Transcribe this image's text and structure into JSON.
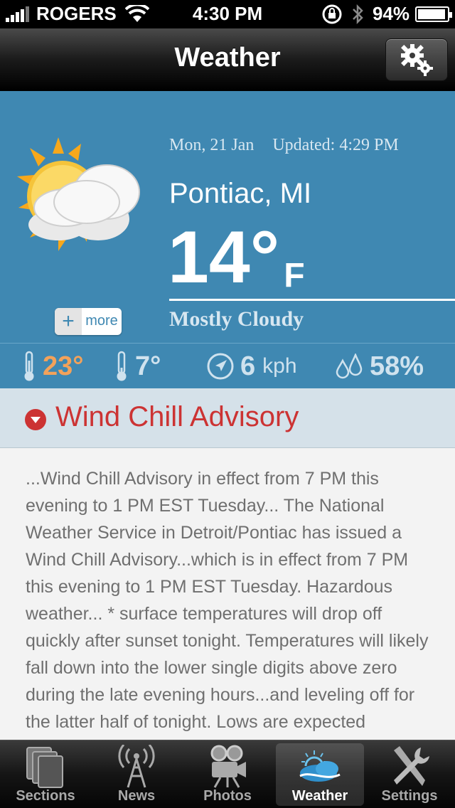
{
  "status_bar": {
    "carrier": "ROGERS",
    "time": "4:30 PM",
    "battery": "94%",
    "battery_level": 0.94
  },
  "nav": {
    "title": "Weather",
    "settings_icon": "gear-icon"
  },
  "current": {
    "date": "Mon, 21 Jan",
    "updated": "Updated: 4:29 PM",
    "location": "Pontiac, MI",
    "temperature": "14°",
    "unit": "F",
    "condition": "Mostly Cloudy",
    "condition_icon": "sun-cloud-icon",
    "more_label": "more",
    "more_symbol": "+"
  },
  "stats": {
    "high": "23°",
    "low": "7°",
    "wind_speed": "6",
    "wind_unit": "kph",
    "humidity": "58%"
  },
  "advisory": {
    "title": "Wind Chill Advisory",
    "body": "...Wind Chill Advisory in effect from 7 PM this evening to 1 PM EST Tuesday... The National Weather Service in Detroit/Pontiac has issued a Wind Chill Advisory...which is in effect from 7 PM this evening to 1 PM EST Tuesday. Hazardous weather... * surface temperatures will drop off quickly after sunset tonight. Temperatures will likely fall down into the lower single digits above zero during the late evening hours...and leveling off for the latter half of tonight. Lows are expected"
  },
  "colors": {
    "panel": "#3f88b2",
    "high_temp": "#f3a25a",
    "advisory_red": "#cc3333"
  },
  "tabs": [
    {
      "label": "Sections",
      "icon": "sections-icon",
      "active": false
    },
    {
      "label": "News",
      "icon": "radio-tower-icon",
      "active": false
    },
    {
      "label": "Photos",
      "icon": "camera-icon",
      "active": false
    },
    {
      "label": "Weather",
      "icon": "weather-icon",
      "active": true
    },
    {
      "label": "Settings",
      "icon": "tools-icon",
      "active": false
    }
  ]
}
